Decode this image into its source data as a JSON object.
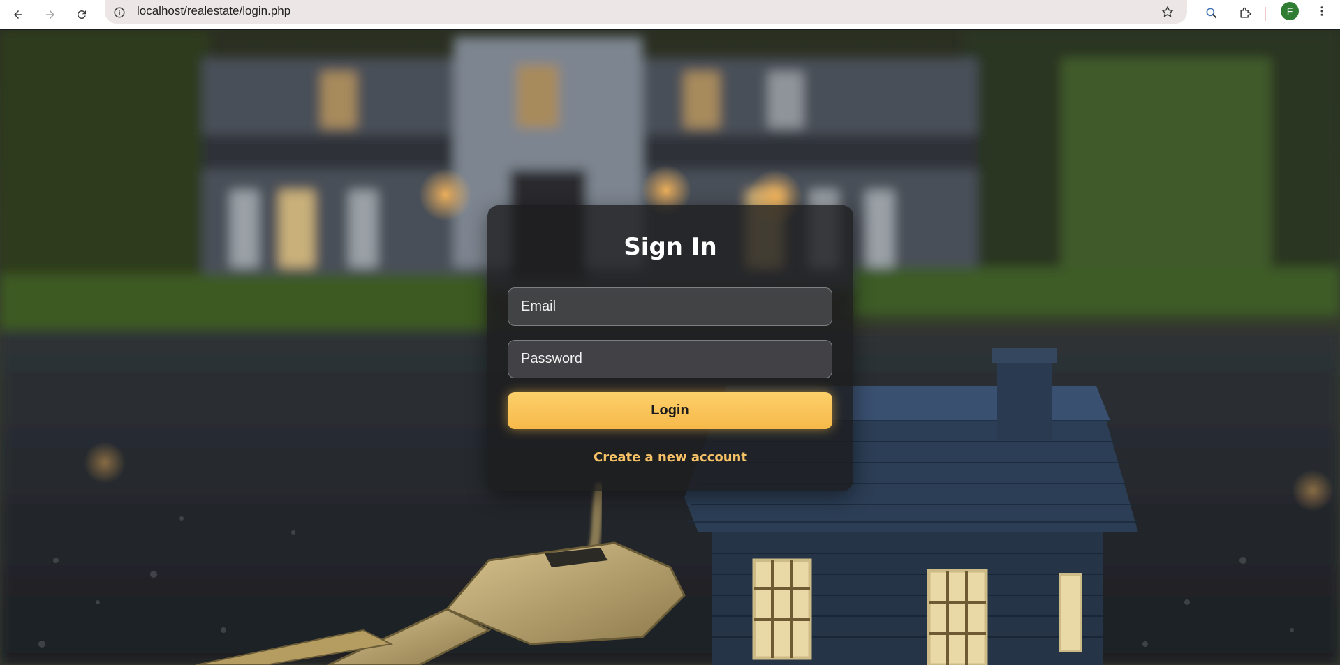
{
  "browser": {
    "url": "localhost/realestate/login.php",
    "profile_initial": "F"
  },
  "login": {
    "title": "Sign In",
    "email_placeholder": "Email",
    "email_value": "",
    "password_placeholder": "Password",
    "password_value": "",
    "login_label": "Login",
    "create_account_label": "Create a new account"
  },
  "colors": {
    "accent": "#f7c266",
    "button": "#fbc85e",
    "card_bg": "#1c1c1e"
  },
  "icons": {
    "back": "arrow-left-icon",
    "forward": "arrow-right-icon",
    "reload": "reload-icon",
    "site_info": "info-icon",
    "bookmark": "star-icon",
    "lens": "lens-icon",
    "extensions": "puzzle-icon",
    "menu": "more-vertical-icon"
  }
}
